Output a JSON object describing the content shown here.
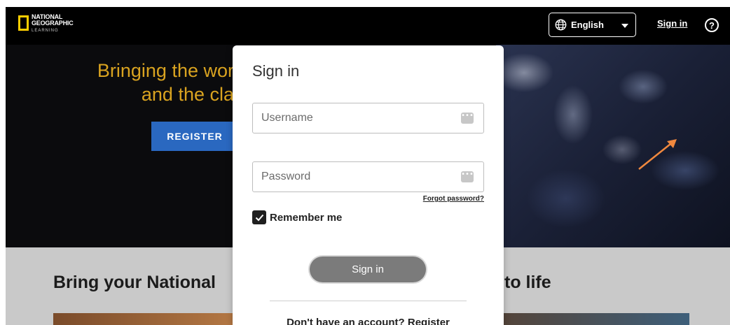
{
  "header": {
    "logo_line1": "NATIONAL",
    "logo_line2": "GEOGRAPHIC",
    "logo_line3": "LEARNING",
    "language": "English",
    "signin_link": "Sign in",
    "help": "?"
  },
  "hero": {
    "title_line1": "Bringing the wor",
    "title_line2": "and the cla",
    "register_button": "REGISTER"
  },
  "lower": {
    "heading_left": "Bring your National",
    "heading_right": "to life"
  },
  "modal": {
    "title": "Sign in",
    "username_placeholder": "Username",
    "password_placeholder": "Password",
    "forgot_password": "Forgot password?",
    "remember_me": "Remember me",
    "remember_checked": true,
    "signin_button": "Sign in",
    "no_account_text": "Don't have an account?",
    "register_link": "Register"
  },
  "colors": {
    "hero_title": "#d9a320",
    "register_button": "#2a68c0",
    "logo_yellow": "#ffce00",
    "annotation_arrow": "#f0883e"
  },
  "icons": {
    "language": "globe-icon",
    "help": "help-circle-icon",
    "dropdown": "chevron-down-icon",
    "field": "password-manager-icon",
    "checkbox": "checkmark-icon"
  }
}
